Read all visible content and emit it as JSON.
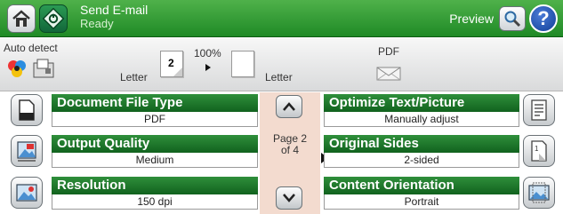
{
  "header": {
    "title": "Send E-mail",
    "status": "Ready",
    "preview_label": "Preview",
    "help_symbol": "?"
  },
  "statusbar": {
    "auto_detect": "Auto detect",
    "paper_left": "Letter",
    "zoom": "100%",
    "paper_right": "Letter",
    "output_format": "PDF",
    "sides_page_label": "2"
  },
  "pager": {
    "page_text": "Page 2",
    "of_text": "of 4"
  },
  "options_left": [
    {
      "label": "Document File Type",
      "value": "PDF",
      "icon": "document-icon"
    },
    {
      "label": "Output Quality",
      "value": "Medium",
      "icon": "quality-icon"
    },
    {
      "label": "Resolution",
      "value": "150 dpi",
      "icon": "resolution-icon"
    }
  ],
  "options_right": [
    {
      "label": "Optimize Text/Picture",
      "value": "Manually adjust",
      "icon": "text-picture-icon"
    },
    {
      "label": "Original Sides",
      "value": "2-sided",
      "icon": "sides-icon"
    },
    {
      "label": "Content Orientation",
      "value": "Portrait",
      "icon": "orientation-icon"
    }
  ],
  "colors": {
    "header_green": "#1f8a26",
    "field_green": "#11621e",
    "center_panel": "#f3dbcf"
  }
}
